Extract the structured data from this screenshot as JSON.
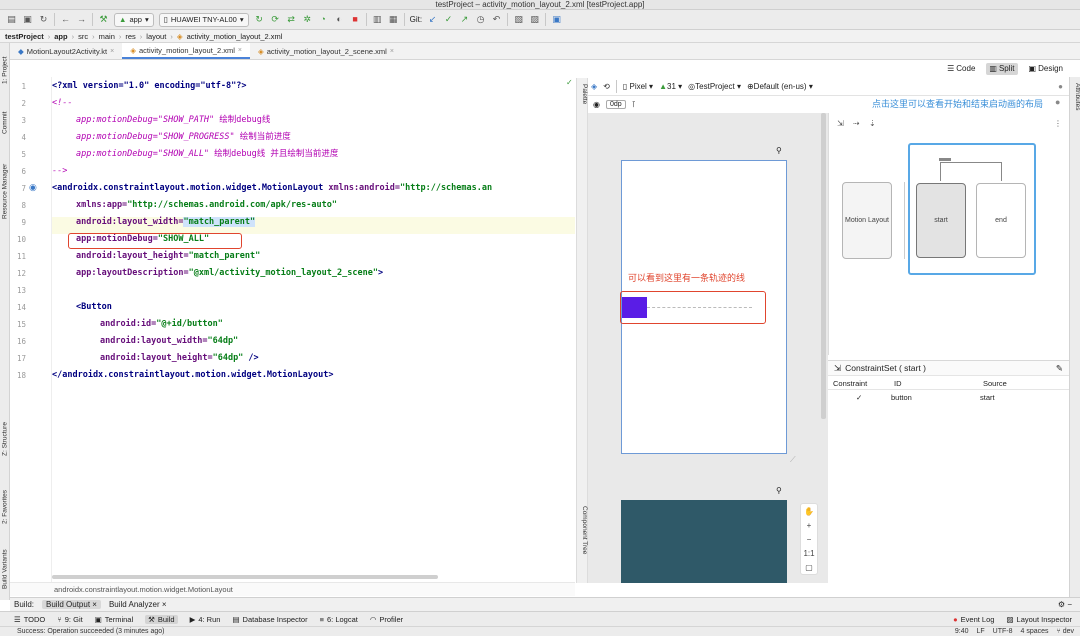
{
  "window_title": "testProject – activity_motion_layout_2.xml [testProject.app]",
  "toolbar": {
    "run_config": "app",
    "device": "HUAWEI TNY-AL00",
    "git_label": "Git:"
  },
  "breadcrumb": [
    "testProject",
    "app",
    "src",
    "main",
    "res",
    "layout",
    "activity_motion_layout_2.xml"
  ],
  "file_tabs": [
    {
      "label": "MotionLayout2Activity.kt",
      "active": false
    },
    {
      "label": "activity_motion_layout_2.xml",
      "active": true
    },
    {
      "label": "activity_motion_layout_2_scene.xml",
      "active": false
    }
  ],
  "view_modes": {
    "code": "Code",
    "split": "Split",
    "design": "Design"
  },
  "left_tools": [
    "1: Project",
    "Commit",
    "Resource Manager",
    "Z: Structure",
    "2: Favorites",
    "Build Variants"
  ],
  "right_tools": [
    "Attributes"
  ],
  "editor": {
    "line_numbers": [
      "1",
      "2",
      "3",
      "4",
      "5",
      "6",
      "7",
      "8",
      "9",
      "10",
      "11",
      "12",
      "13",
      "14",
      "15",
      "16",
      "17",
      "18"
    ],
    "lines": {
      "l1": "<?xml version=\"1.0\" encoding=\"utf-8\"?>",
      "l2": "<!--",
      "l3a": "app:motionDebug=\"SHOW_PATH\"",
      "l3b": " 绘制debug线",
      "l4a": "app:motionDebug=\"SHOW_PROGRESS\"",
      "l4b": " 绘制当前进度",
      "l5a": "app:motionDebug=\"SHOW_ALL\"",
      "l5b": " 绘制debug线 并且绘制当前进度",
      "l6": "-->",
      "l7a": "<androidx.constraintlayout.motion.widget.MotionLayout",
      "l7b": " xmlns:android=",
      "l7c": "\"http://schemas.an",
      "l8a": "xmlns:app=",
      "l8b": "\"http://schemas.android.com/apk/res-auto\"",
      "l9a": "android:layout_width=",
      "l9b": "\"match_parent\"",
      "l10a": "app:motionDebug=",
      "l10b": "\"SHOW_ALL\"",
      "l11a": "android:layout_height=",
      "l11b": "\"match_parent\"",
      "l12a": "app:layoutDescription=",
      "l12b": "\"@xml/activity_motion_layout_2_scene\"",
      "l12c": ">",
      "l14": "<Button",
      "l15a": "android:id=",
      "l15b": "\"@+id/button\"",
      "l16a": "android:layout_width=",
      "l16b": "\"64dp\"",
      "l17a": "android:layout_height=",
      "l17b": "\"64dp\"",
      "l17c": " />",
      "l18": "</androidx.constraintlayout.motion.widget.MotionLayout>"
    },
    "status_path": "androidx.constraintlayout.motion.widget.MotionLayout"
  },
  "design_toolbar": {
    "device": "Pixel",
    "api": "31",
    "theme": "TestProject",
    "locale": "Default (en-us)",
    "dp_value": "0dp"
  },
  "palette_label": "Palette",
  "component_tree_label": "Component Tree",
  "canvas_note": "可以看到这里有一条轨迹的线",
  "motion_editor": {
    "note": "点击这里可以查看开始和结束启动画的布局",
    "motion_layout_label": "Motion Layout",
    "start_label": "start",
    "end_label": "end",
    "constraint_set_title": "ConstraintSet ( start )",
    "table_headers": [
      "Constraint",
      "ID",
      "Source"
    ],
    "table_rows": [
      {
        "constraint": "✓",
        "id": "button",
        "source": "start"
      }
    ]
  },
  "zoom": {
    "plus": "+",
    "minus": "−",
    "ratio": "1:1"
  },
  "build_panel": {
    "label": "Build:",
    "tabs": [
      "Build Output",
      "Build Analyzer"
    ]
  },
  "tool_windows": [
    "TODO",
    "9: Git",
    "Terminal",
    "Build",
    "4: Run",
    "Database Inspector",
    "6: Logcat",
    "Profiler"
  ],
  "tool_windows_right": [
    "Event Log",
    "Layout Inspector"
  ],
  "status": {
    "message": "Success: Operation succeeded (3 minutes ago)",
    "position": "9:40",
    "line_sep": "LF",
    "encoding": "UTF-8",
    "indent": "4 spaces",
    "branch": "dev"
  }
}
